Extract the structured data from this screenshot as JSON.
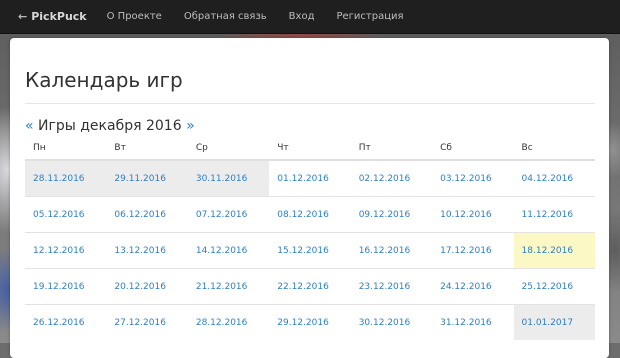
{
  "navbar": {
    "brand": "PickPuck",
    "links": [
      "О Проекте",
      "Обратная связь",
      "Вход",
      "Регистрация"
    ]
  },
  "page": {
    "title": "Календарь игр",
    "month_label": "Игры декабря 2016",
    "prev_arrow": "«",
    "next_arrow": "»"
  },
  "calendar": {
    "weekdays": [
      "Пн",
      "Вт",
      "Ср",
      "Чт",
      "Пт",
      "Сб",
      "Вс"
    ],
    "weeks": [
      [
        "28.11.2016",
        "29.11.2016",
        "30.11.2016",
        "01.12.2016",
        "02.12.2016",
        "03.12.2016",
        "04.12.2016"
      ],
      [
        "05.12.2016",
        "06.12.2016",
        "07.12.2016",
        "08.12.2016",
        "09.12.2016",
        "10.12.2016",
        "11.12.2016"
      ],
      [
        "12.12.2016",
        "13.12.2016",
        "14.12.2016",
        "15.12.2016",
        "16.12.2016",
        "17.12.2016",
        "18.12.2016"
      ],
      [
        "19.12.2016",
        "20.12.2016",
        "21.12.2016",
        "22.12.2016",
        "23.12.2016",
        "24.12.2016",
        "25.12.2016"
      ],
      [
        "26.12.2016",
        "27.12.2016",
        "28.12.2016",
        "29.12.2016",
        "30.12.2016",
        "31.12.2016",
        "01.01.2017"
      ]
    ],
    "colors": {
      "link": "#2f7fc1",
      "other_month_bg": "#ececec",
      "today_bg": "#fcf8c5"
    }
  }
}
